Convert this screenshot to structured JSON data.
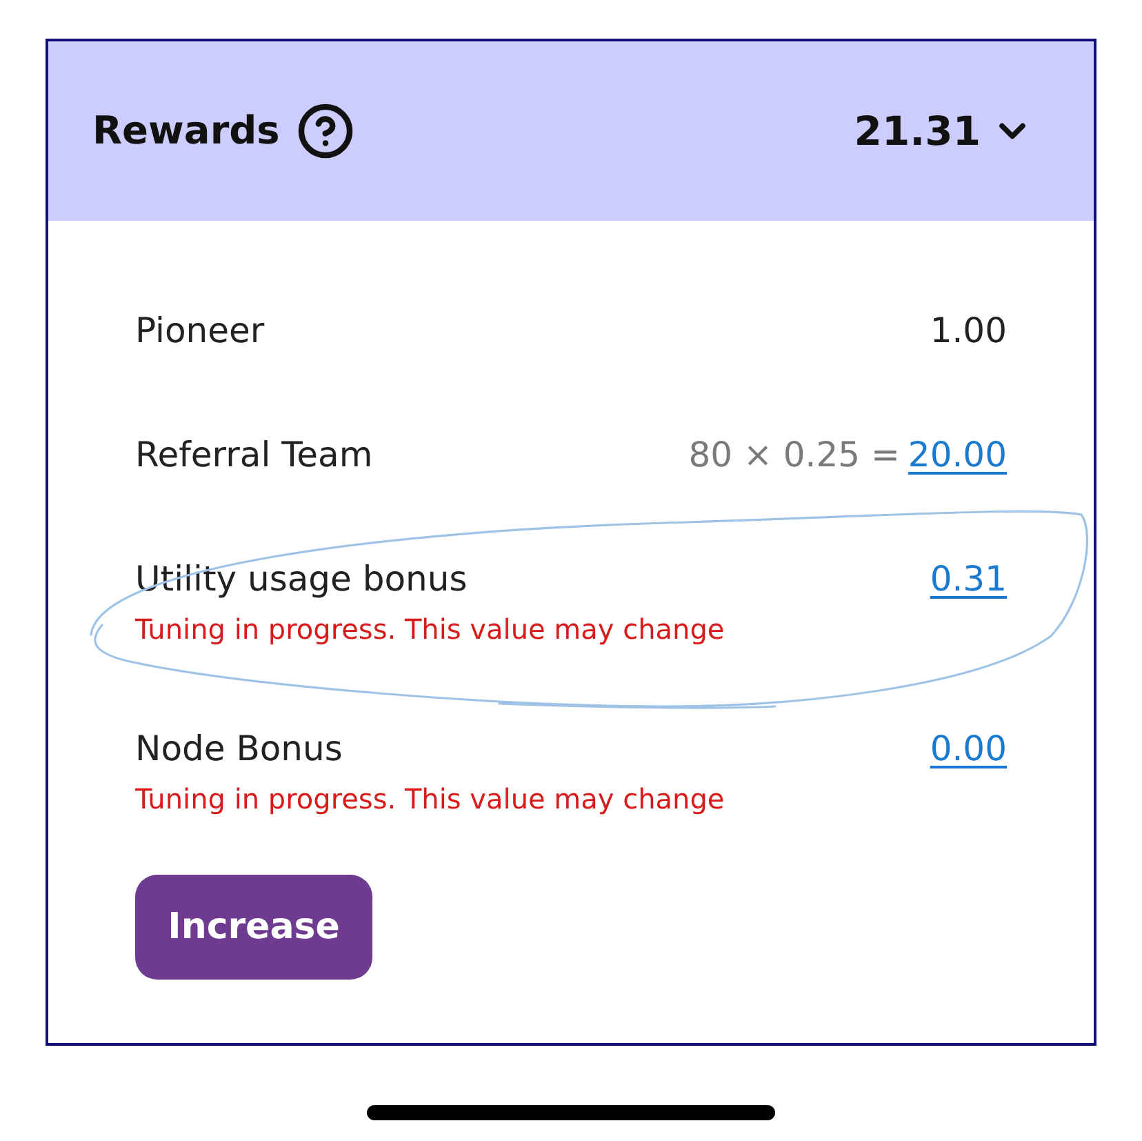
{
  "header": {
    "title": "Rewards",
    "total": "21.31"
  },
  "rows": [
    {
      "label": "Pioneer",
      "value": "1.00",
      "link": false,
      "circled": false
    },
    {
      "label": "Referral Team",
      "formula": "80 × 0.25 =",
      "value": "20.00",
      "link": true,
      "circled": false
    },
    {
      "label": "Utility usage bonus",
      "value": "0.31",
      "link": true,
      "note": "Tuning in progress. This value may change",
      "circled": true
    },
    {
      "label": "Node Bonus",
      "value": "0.00",
      "link": true,
      "note": "Tuning in progress. This value may change",
      "circled": false
    }
  ],
  "button": {
    "label": "Increase"
  }
}
